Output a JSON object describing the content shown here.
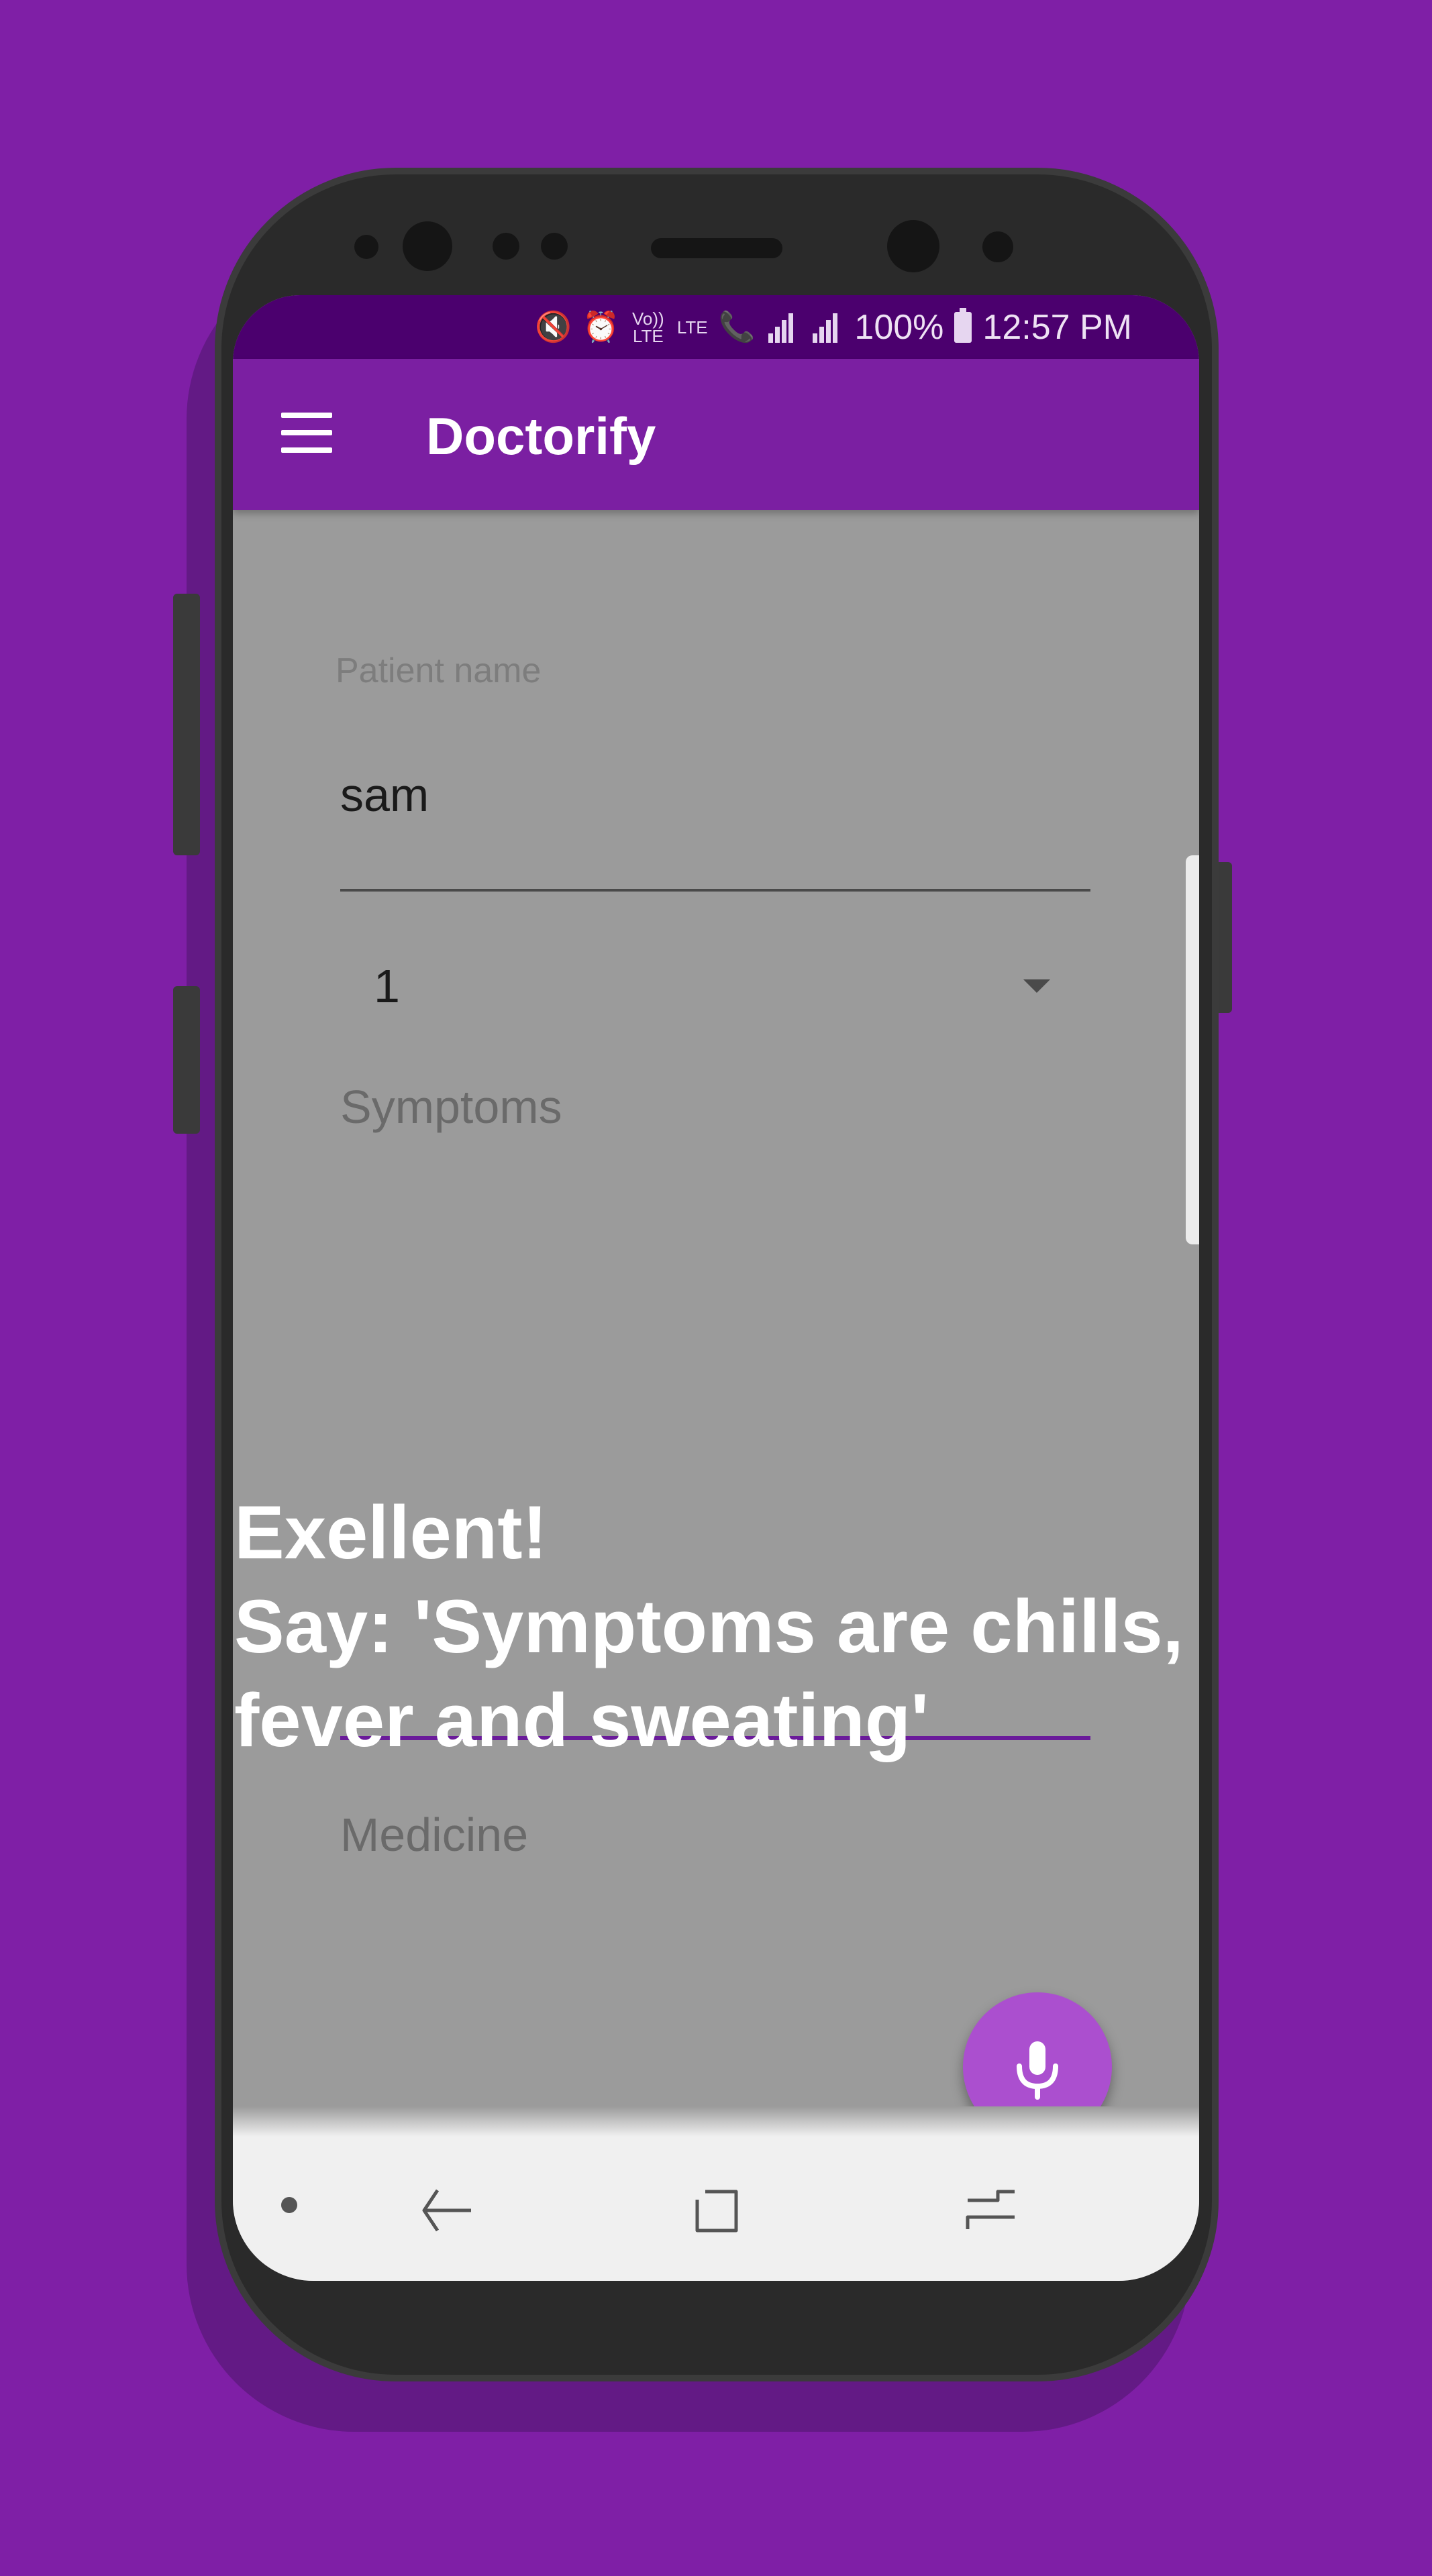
{
  "status_bar": {
    "battery": "100%",
    "time": "12:57 PM",
    "volte": "Vo)) LTE",
    "lte": "LTE"
  },
  "app_bar": {
    "title": "Doctorify",
    "menu_icon": "hamburger-menu-icon"
  },
  "form": {
    "patient_name_label": "Patient name",
    "patient_name_value": "sam",
    "spinner_value": "1",
    "symptoms_label": "Symptoms",
    "medicine_label": "Medicine"
  },
  "prompt": {
    "text": "Exellent!\nSay: 'Symptoms are chills, fever and sweating'"
  },
  "fab": {
    "icon": "microphone-icon"
  },
  "nav_bar": {
    "icons": [
      "dot-icon",
      "back-arrow-icon",
      "home-square-icon",
      "recents-icon"
    ]
  },
  "colors": {
    "background": "#7f1fa6",
    "status_bar": "#4b006e",
    "app_bar": "#7b1fa2",
    "fab": "#ab4fcf",
    "accent_underline": "#6a1b9a"
  }
}
